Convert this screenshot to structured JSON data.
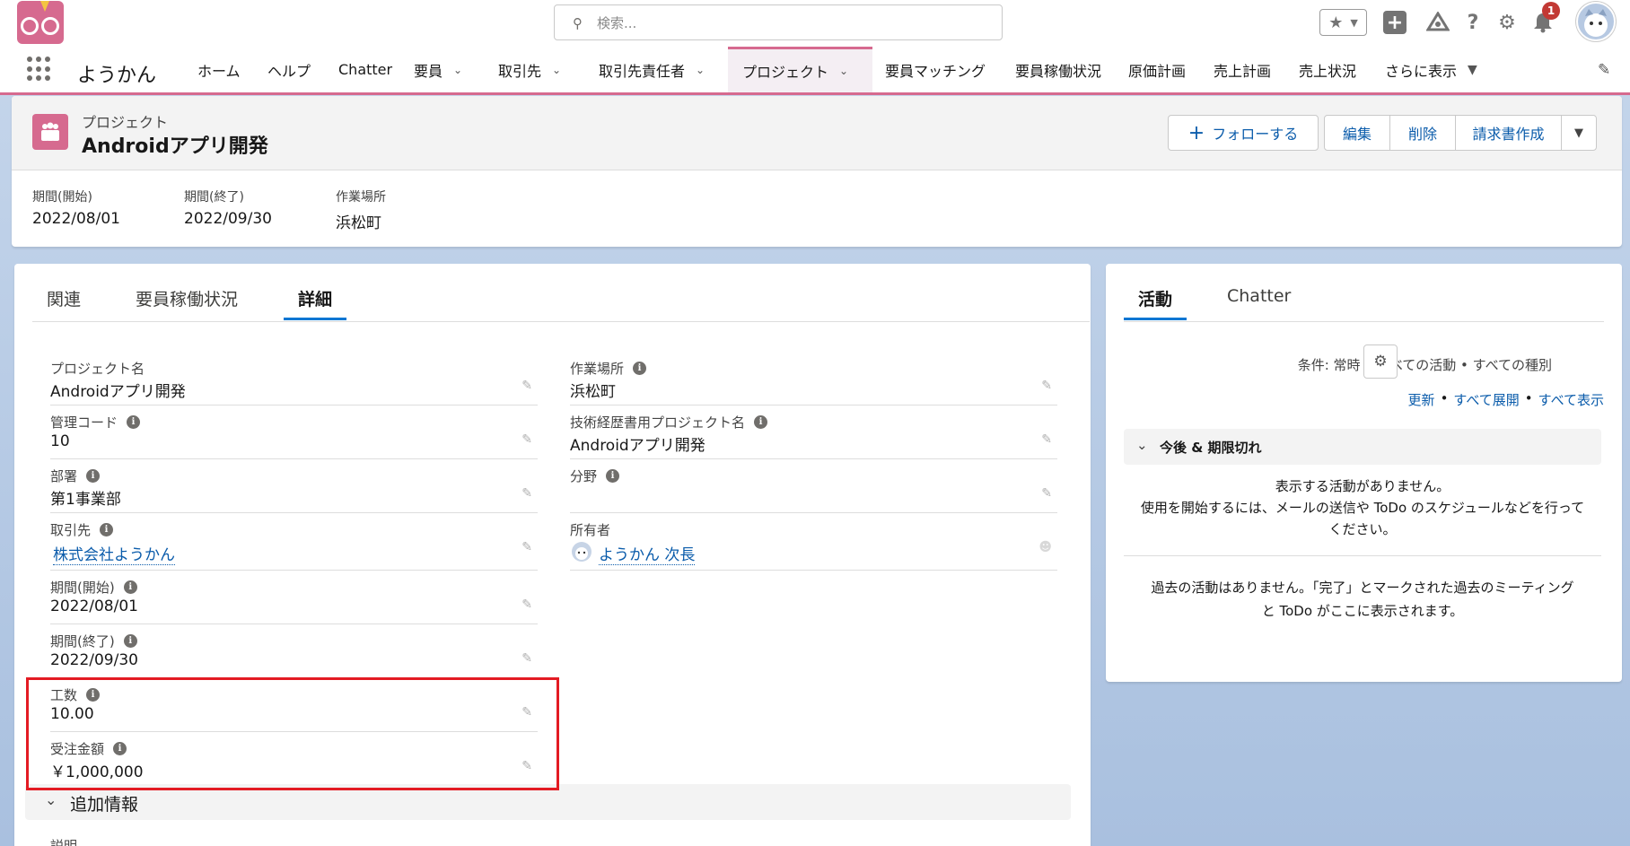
{
  "search": {
    "placeholder": "検索..."
  },
  "notifications": {
    "count": "1"
  },
  "nav": {
    "app_name": "ようかん",
    "items": [
      {
        "label": "ホーム",
        "dropdown": false
      },
      {
        "label": "ヘルプ",
        "dropdown": false
      },
      {
        "label": "Chatter",
        "dropdown": false
      },
      {
        "label": "要員",
        "dropdown": true
      },
      {
        "label": "取引先",
        "dropdown": true
      },
      {
        "label": "取引先責任者",
        "dropdown": true
      },
      {
        "label": "プロジェクト",
        "dropdown": true,
        "active": true
      },
      {
        "label": "要員マッチング",
        "dropdown": false
      },
      {
        "label": "要員稼働状況",
        "dropdown": false
      },
      {
        "label": "原価計画",
        "dropdown": false
      },
      {
        "label": "売上計画",
        "dropdown": false
      },
      {
        "label": "売上状況",
        "dropdown": false
      },
      {
        "label": "さらに表示",
        "dropdown": true
      }
    ]
  },
  "record": {
    "object_type": "プロジェクト",
    "title": "Androidアプリ開発",
    "actions": {
      "follow": "フォローする",
      "edit": "編集",
      "delete": "削除",
      "invoice": "請求書作成"
    },
    "highlights": [
      {
        "label": "期間(開始)",
        "value": "2022/08/01"
      },
      {
        "label": "期間(終了)",
        "value": "2022/09/30"
      },
      {
        "label": "作業場所",
        "value": "浜松町"
      }
    ]
  },
  "tabs": [
    "関連",
    "要員稼働状況",
    "詳細"
  ],
  "details": {
    "left": [
      {
        "label": "プロジェクト名",
        "value": "Androidアプリ開発",
        "info": false
      },
      {
        "label": "管理コード",
        "value": "10",
        "info": true
      },
      {
        "label": "部署",
        "value": "第1事業部",
        "info": true
      },
      {
        "label": "取引先",
        "value": "株式会社ようかん",
        "info": true,
        "link": true
      },
      {
        "label": "期間(開始)",
        "value": "2022/08/01",
        "info": true
      },
      {
        "label": "期間(終了)",
        "value": "2022/09/30",
        "info": true
      },
      {
        "label": "工数",
        "value": "10.00",
        "info": true
      },
      {
        "label": "受注金額",
        "value": "￥1,000,000",
        "info": true
      }
    ],
    "right": [
      {
        "label": "作業場所",
        "value": "浜松町",
        "info": true
      },
      {
        "label": "技術経歴書用プロジェクト名",
        "value": "Androidアプリ開発",
        "info": true
      },
      {
        "label": "分野",
        "value": "",
        "info": true
      },
      {
        "label": "所有者",
        "value": "ようかん 次長",
        "info": false,
        "link": true
      }
    ],
    "section_title": "追加情報",
    "next_label": "説明"
  },
  "activity": {
    "tabs": [
      "活動",
      "Chatter"
    ],
    "filter": "条件: 常時 • すべての活動 • すべての種別",
    "links": [
      "更新",
      "すべて展開",
      "すべて表示"
    ],
    "upcoming_title": "今後 & 期限切れ",
    "empty_line1": "表示する活動がありません。",
    "empty_line2": "使用を開始するには、メールの送信や ToDo のスケジュールなどを行って",
    "empty_line3": "ください。",
    "past_line1": "過去の活動はありません。「完了」とマークされた過去のミーティング",
    "past_line2": "と ToDo がここに表示されます。"
  },
  "colors": {
    "brand": "#d66a8f",
    "link": "#0b5cab",
    "highlight_border": "#e31b23",
    "tab_active": "#0176d3"
  }
}
